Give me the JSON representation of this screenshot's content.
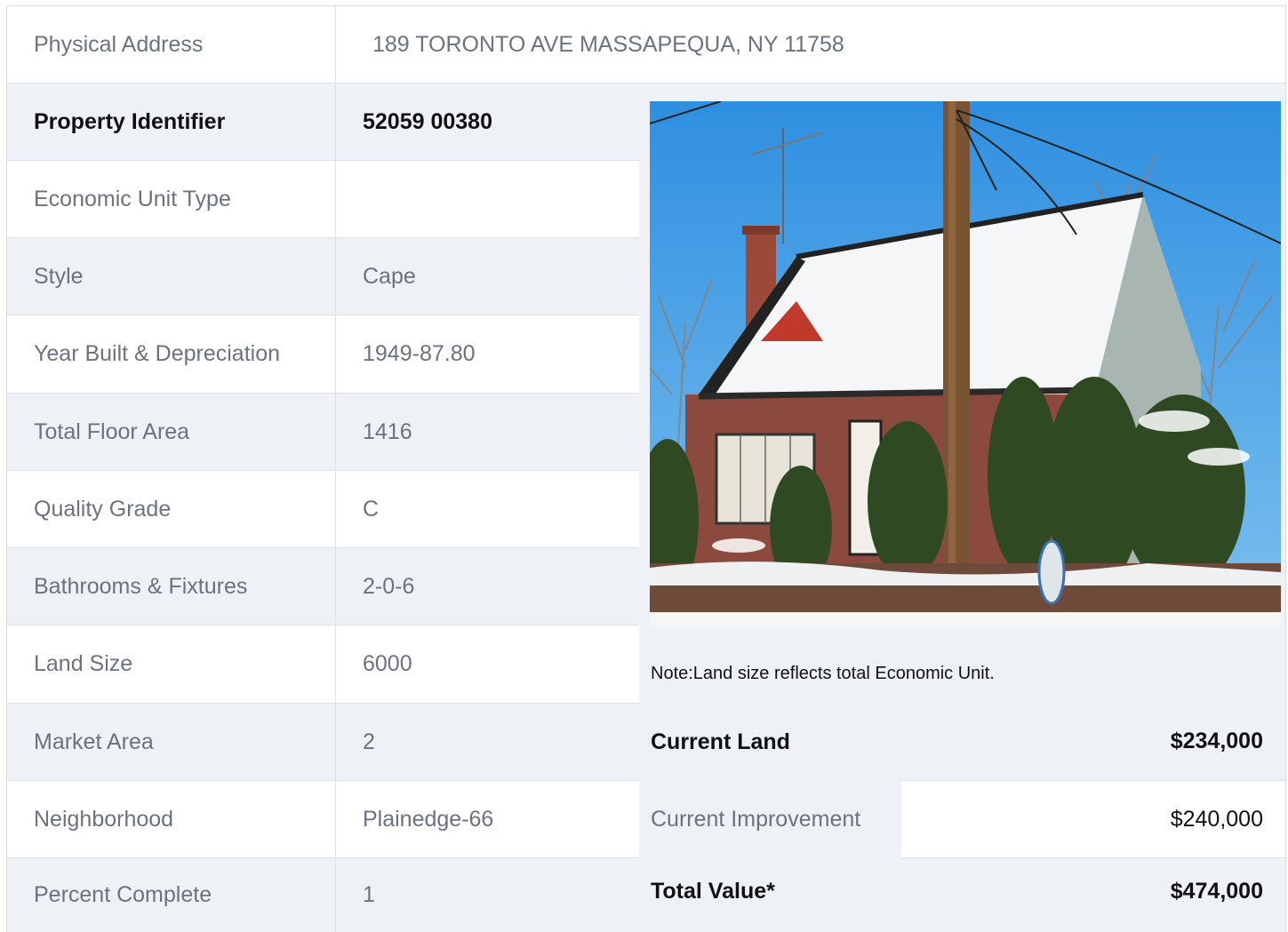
{
  "address": {
    "label": "Physical Address",
    "value": "189  TORONTO AVE  MASSAPEQUA, NY  11758"
  },
  "details": [
    {
      "label": "Property Identifier",
      "value": "52059  00380"
    },
    {
      "label": "Economic Unit Type",
      "value": ""
    },
    {
      "label": "Style",
      "value": "Cape"
    },
    {
      "label": "Year Built & Depreciation",
      "value": "1949-87.80"
    },
    {
      "label": "Total Floor Area",
      "value": "1416"
    },
    {
      "label": "Quality Grade",
      "value": "C"
    },
    {
      "label": "Bathrooms & Fixtures",
      "value": "2-0-6"
    },
    {
      "label": "Land Size",
      "value": "6000"
    },
    {
      "label": "Market Area",
      "value": "2"
    },
    {
      "label": "Neighborhood",
      "value": "Plainedge-66"
    },
    {
      "label": "Percent Complete",
      "value": "1"
    }
  ],
  "note": "Note:Land size reflects total Economic Unit.",
  "valuation": [
    {
      "label": "Current Land",
      "value": "$234,000"
    },
    {
      "label": "Current Improvement",
      "value": "$240,000"
    },
    {
      "label": "Total Value*",
      "value": "$474,000"
    }
  ],
  "colors": {
    "shade": "#eef1f5",
    "text_muted": "#6b7280",
    "text_bold": "#111111"
  }
}
